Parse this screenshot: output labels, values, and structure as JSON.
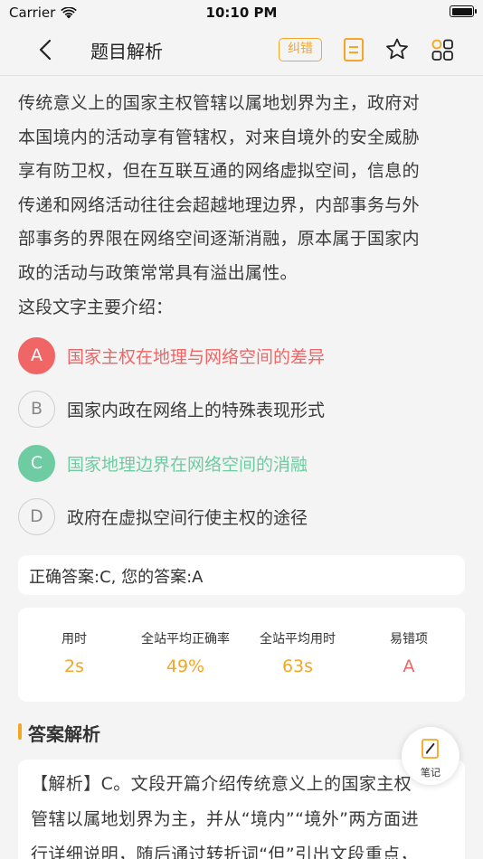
{
  "status": {
    "carrier": "Carrier",
    "time": "10:10 PM"
  },
  "nav": {
    "title": "题目解析",
    "correct_label": "纠错"
  },
  "question": {
    "stem_lines": [
      "传统意义上的国家主权管辖以属地划界为主，政府对",
      "本国境内的活动享有管辖权，对来自境外的安全威胁",
      "享有防卫权，但在互联互通的网络虚拟空间，信息的",
      "传递和网络活动往往会超越地理边界，内部事务与外",
      "部事务的界限在网络空间逐渐消融，原本属于国家内",
      "政的活动与政策常常具有溢出属性。"
    ],
    "prompt": "这段文字主要介绍："
  },
  "options": [
    {
      "letter": "A",
      "text": "国家主权在地理与网络空间的差异",
      "state": "wrong"
    },
    {
      "letter": "B",
      "text": "国家内政在网络上的特殊表现形式",
      "state": "normal"
    },
    {
      "letter": "C",
      "text": "国家地理边界在网络空间的消融",
      "state": "right"
    },
    {
      "letter": "D",
      "text": "政府在虚拟空间行使主权的途径",
      "state": "normal"
    }
  ],
  "answer_text": "正确答案:C, 您的答案:A",
  "stats": [
    {
      "label": "用时",
      "value": "2s"
    },
    {
      "label": "全站平均正确率",
      "value": "49%"
    },
    {
      "label": "全站平均用时",
      "value": "63s"
    },
    {
      "label": "易错项",
      "value": "A"
    }
  ],
  "analysis": {
    "title": "答案解析",
    "lines": [
      "【解析】C。文段开篇介绍传统意义上的国家主权",
      "管辖以属地划界为主，并从“境内”“境外”两方面进",
      "行详细说明，随后通过转折词“但”引出文段重点，"
    ]
  },
  "note_button": {
    "label": "笔记"
  },
  "colors": {
    "accent": "#f5a623",
    "wrong": "#f06565",
    "right": "#6fcba1"
  }
}
